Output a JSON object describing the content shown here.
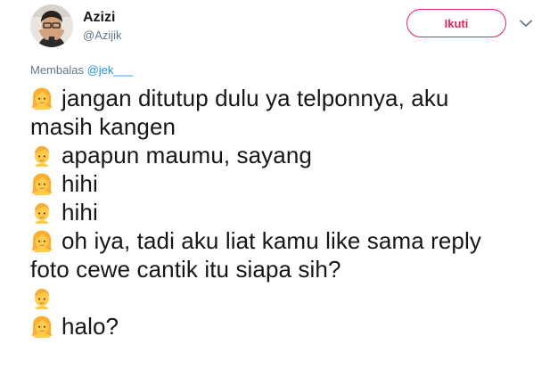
{
  "tweet": {
    "author": {
      "display_name": "Azizi",
      "handle": "@Azijik",
      "avatar_icon": "profile-photo"
    },
    "follow_button_label": "Ikuti",
    "menu_icon": "chevron-down-icon",
    "reply_prefix": "Membalas",
    "reply_mention": "@jek___",
    "lines": [
      {
        "emoji": "girl-emoji",
        "text": "jangan ditutup dulu ya telponnya, aku"
      },
      {
        "emoji": "",
        "text": "masih kangen"
      },
      {
        "emoji": "boy-emoji",
        "text": "apapun maumu, sayang"
      },
      {
        "emoji": "girl-emoji",
        "text": "hihi"
      },
      {
        "emoji": "boy-emoji",
        "text": "hihi"
      },
      {
        "emoji": "girl-emoji",
        "text": "oh iya, tadi aku liat kamu like sama reply"
      },
      {
        "emoji": "",
        "text": "foto cewe cantik itu siapa sih?"
      },
      {
        "emoji": "boy-emoji",
        "text": ""
      },
      {
        "emoji": "girl-emoji",
        "text": "halo?"
      }
    ]
  },
  "colors": {
    "accent": "#e0245e",
    "mention": "#1b95e0",
    "secondary_text": "#657786",
    "body_text": "#14171a",
    "emoji_face": "#ffcc4d",
    "emoji_hair": "#ffac33"
  }
}
